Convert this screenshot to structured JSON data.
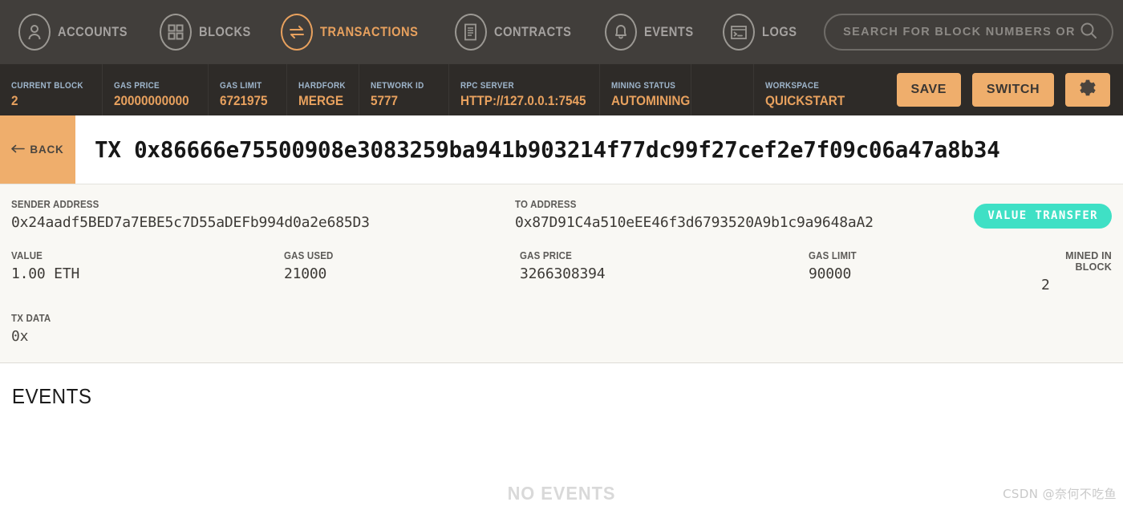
{
  "nav": {
    "items": [
      {
        "label": "ACCOUNTS",
        "icon": "user-icon",
        "active": false
      },
      {
        "label": "BLOCKS",
        "icon": "grid-icon",
        "active": false
      },
      {
        "label": "TRANSACTIONS",
        "icon": "transfer-arrows-icon",
        "active": true
      },
      {
        "label": "CONTRACTS",
        "icon": "document-icon",
        "active": false
      },
      {
        "label": "EVENTS",
        "icon": "bell-icon",
        "active": false
      },
      {
        "label": "LOGS",
        "icon": "terminal-icon",
        "active": false
      }
    ],
    "search": {
      "placeholder": "SEARCH FOR BLOCK NUMBERS OR TX HASHES",
      "value": "",
      "icon": "search-icon"
    }
  },
  "status": {
    "cells": [
      {
        "label": "CURRENT BLOCK",
        "value": "2"
      },
      {
        "label": "GAS PRICE",
        "value": "20000000000"
      },
      {
        "label": "GAS LIMIT",
        "value": "6721975"
      },
      {
        "label": "HARDFORK",
        "value": "MERGE"
      },
      {
        "label": "NETWORK ID",
        "value": "5777"
      },
      {
        "label": "RPC SERVER",
        "value": "HTTP://127.0.0.1:7545"
      },
      {
        "label": "MINING STATUS",
        "value": "AUTOMINING"
      },
      {
        "label": "WORKSPACE",
        "value": "QUICKSTART"
      }
    ],
    "save_label": "SAVE",
    "switch_label": "SWITCH",
    "settings_icon": "gear-icon"
  },
  "titlebar": {
    "back_label": "BACK",
    "back_icon": "arrow-left-icon",
    "tx_title": "TX 0x86666e75500908e3083259ba941b903214f77dc99f27cef2e7f09c06a47a8b34"
  },
  "detail": {
    "sender": {
      "label": "SENDER ADDRESS",
      "value": "0x24aadf5BED7a7EBE5c7D55aDEFb994d0a2e685D3"
    },
    "to": {
      "label": "TO ADDRESS",
      "value": "0x87D91C4a510eEE46f3d6793520A9b1c9a9648aA2"
    },
    "badge": "VALUE TRANSFER",
    "metrics": [
      {
        "label": "VALUE",
        "value": "1.00 ETH"
      },
      {
        "label": "GAS USED",
        "value": "21000"
      },
      {
        "label": "GAS PRICE",
        "value": "3266308394"
      },
      {
        "label": "GAS LIMIT",
        "value": "90000"
      },
      {
        "label": "MINED IN BLOCK",
        "value": "2"
      }
    ],
    "txdata": {
      "label": "TX DATA",
      "value": "0x"
    }
  },
  "events": {
    "heading": "EVENTS",
    "empty_text": "NO EVENTS"
  },
  "watermark": "CSDN @奈何不吃鱼",
  "colors": {
    "accent": "#E8A15E",
    "button": "#EFAE6C",
    "nav_bg": "#413E3B",
    "status_bg": "#2E2B28",
    "badge": "#3FE0C5",
    "panel_bg": "#F9F8F4",
    "status_label": "#9FB6CC"
  }
}
